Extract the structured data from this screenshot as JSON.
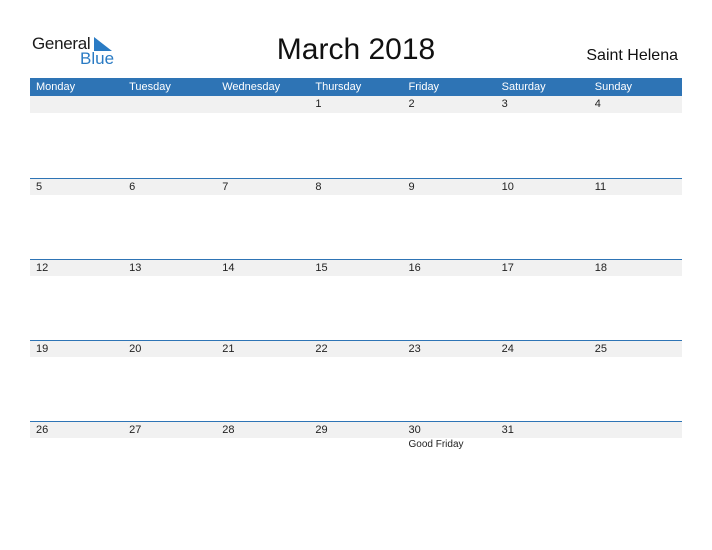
{
  "logo": {
    "general": "General",
    "blue": "Blue"
  },
  "title": "March 2018",
  "country": "Saint Helena",
  "colors": {
    "accent": "#2e74b5",
    "row_bg": "#f1f1f1"
  },
  "weekdays": [
    "Monday",
    "Tuesday",
    "Wednesday",
    "Thursday",
    "Friday",
    "Saturday",
    "Sunday"
  ],
  "weeks": [
    {
      "days": [
        "",
        "",
        "",
        "1",
        "2",
        "3",
        "4"
      ],
      "holidays": [
        "",
        "",
        "",
        "",
        "",
        "",
        ""
      ]
    },
    {
      "days": [
        "5",
        "6",
        "7",
        "8",
        "9",
        "10",
        "11"
      ],
      "holidays": [
        "",
        "",
        "",
        "",
        "",
        "",
        ""
      ]
    },
    {
      "days": [
        "12",
        "13",
        "14",
        "15",
        "16",
        "17",
        "18"
      ],
      "holidays": [
        "",
        "",
        "",
        "",
        "",
        "",
        ""
      ]
    },
    {
      "days": [
        "19",
        "20",
        "21",
        "22",
        "23",
        "24",
        "25"
      ],
      "holidays": [
        "",
        "",
        "",
        "",
        "",
        "",
        ""
      ]
    },
    {
      "days": [
        "26",
        "27",
        "28",
        "29",
        "30",
        "31",
        ""
      ],
      "holidays": [
        "",
        "",
        "",
        "",
        "Good Friday",
        "",
        ""
      ]
    }
  ]
}
